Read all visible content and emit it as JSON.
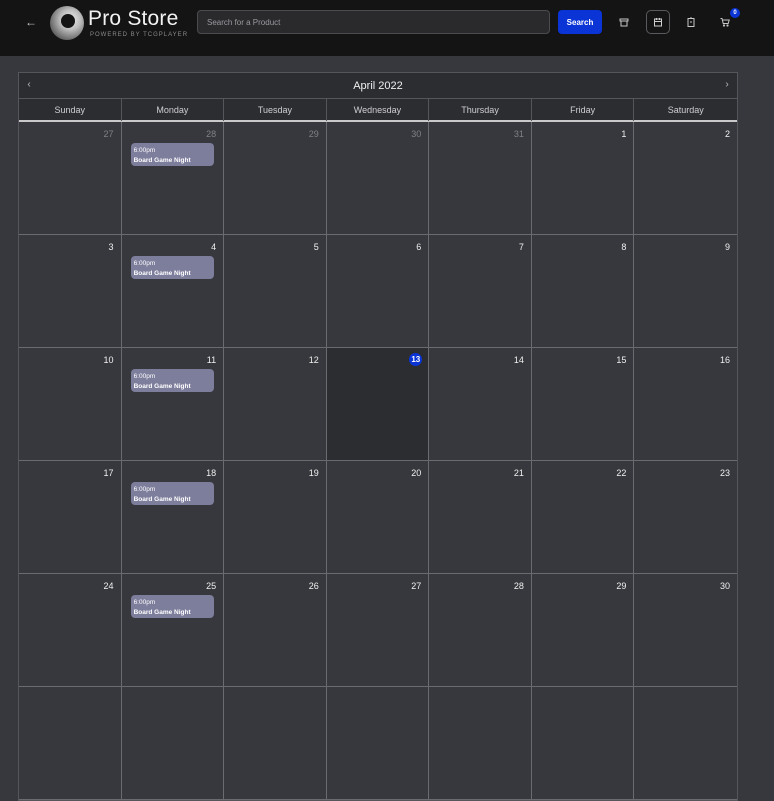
{
  "header": {
    "brand": "Pro Store",
    "brand_sub": "POWERED BY TCGPLAYER",
    "search_placeholder": "Search for a Product",
    "search_label": "Search",
    "cart_count": "0",
    "icons": [
      "back-arrow-icon",
      "storefront-icon",
      "calendar-icon",
      "clipboard-icon",
      "cart-icon"
    ]
  },
  "calendar": {
    "title": "April 2022",
    "prev_label": "‹",
    "next_label": "›",
    "weekdays": [
      "Sunday",
      "Monday",
      "Tuesday",
      "Wednesday",
      "Thursday",
      "Friday",
      "Saturday"
    ],
    "today": "13",
    "weeks": [
      [
        {
          "d": "27",
          "o": true
        },
        {
          "d": "28",
          "o": true,
          "e": true
        },
        {
          "d": "29",
          "o": true
        },
        {
          "d": "30",
          "o": true
        },
        {
          "d": "31",
          "o": true
        },
        {
          "d": "1"
        },
        {
          "d": "2"
        }
      ],
      [
        {
          "d": "3"
        },
        {
          "d": "4",
          "e": true
        },
        {
          "d": "5"
        },
        {
          "d": "6"
        },
        {
          "d": "7"
        },
        {
          "d": "8"
        },
        {
          "d": "9"
        }
      ],
      [
        {
          "d": "10"
        },
        {
          "d": "11",
          "e": true
        },
        {
          "d": "12"
        },
        {
          "d": "13",
          "t": true
        },
        {
          "d": "14"
        },
        {
          "d": "15"
        },
        {
          "d": "16"
        }
      ],
      [
        {
          "d": "17"
        },
        {
          "d": "18",
          "e": true
        },
        {
          "d": "19"
        },
        {
          "d": "20"
        },
        {
          "d": "21"
        },
        {
          "d": "22"
        },
        {
          "d": "23"
        }
      ],
      [
        {
          "d": "24"
        },
        {
          "d": "25",
          "e": true
        },
        {
          "d": "26"
        },
        {
          "d": "27"
        },
        {
          "d": "28"
        },
        {
          "d": "29"
        },
        {
          "d": "30"
        }
      ],
      [
        {
          "d": ""
        },
        {
          "d": ""
        },
        {
          "d": ""
        },
        {
          "d": ""
        },
        {
          "d": ""
        },
        {
          "d": ""
        },
        {
          "d": ""
        }
      ]
    ],
    "event": {
      "time": "6:00pm",
      "title": "Board Game Night"
    }
  },
  "colors": {
    "accent": "#0a34d6",
    "event": "#7d7d9c"
  }
}
